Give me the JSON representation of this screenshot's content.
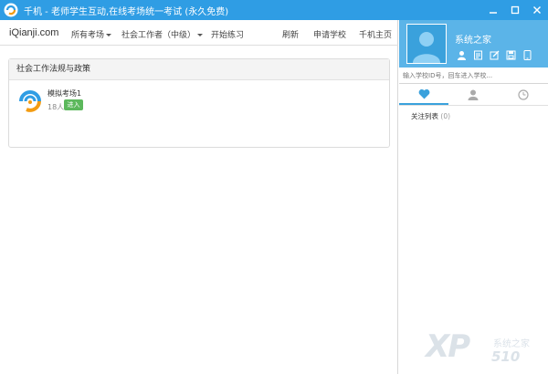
{
  "window": {
    "title": "千机 - 老师学生互动,在线考场统一考试 (永久免费)",
    "controls": [
      "minimize",
      "maximize",
      "close"
    ]
  },
  "nav": {
    "brand": "iQianji.com",
    "all_exams": "所有考场",
    "category": "社会工作者（中级）",
    "practice": "开始练习",
    "refresh": "刷新",
    "apply_school": "申请学校",
    "home": "千机主页"
  },
  "panel": {
    "heading": "社会工作法规与政策",
    "item": {
      "name": "模拟考场1",
      "count": "18人",
      "enter_label": "进入"
    }
  },
  "profile": {
    "username": "系统之家",
    "tools": [
      "user-icon",
      "notes-icon",
      "edit-icon",
      "save-icon",
      "phone-icon"
    ]
  },
  "search": {
    "placeholder": "输入学校ID号，回车进入学校..."
  },
  "tabs": [
    "favorites-heart-icon",
    "contacts-person-icon",
    "history-clock-icon"
  ],
  "follow": {
    "label": "关注列表",
    "count": "(0)"
  },
  "watermark": {
    "xp": "XP",
    "site_cn": "系统之家",
    "site_num": "510"
  },
  "colors": {
    "titlebar": "#2f9de4",
    "profile_bg": "#5bb4e8",
    "enter_button": "#5cb85c",
    "tab_active": "#3aa1dc"
  }
}
